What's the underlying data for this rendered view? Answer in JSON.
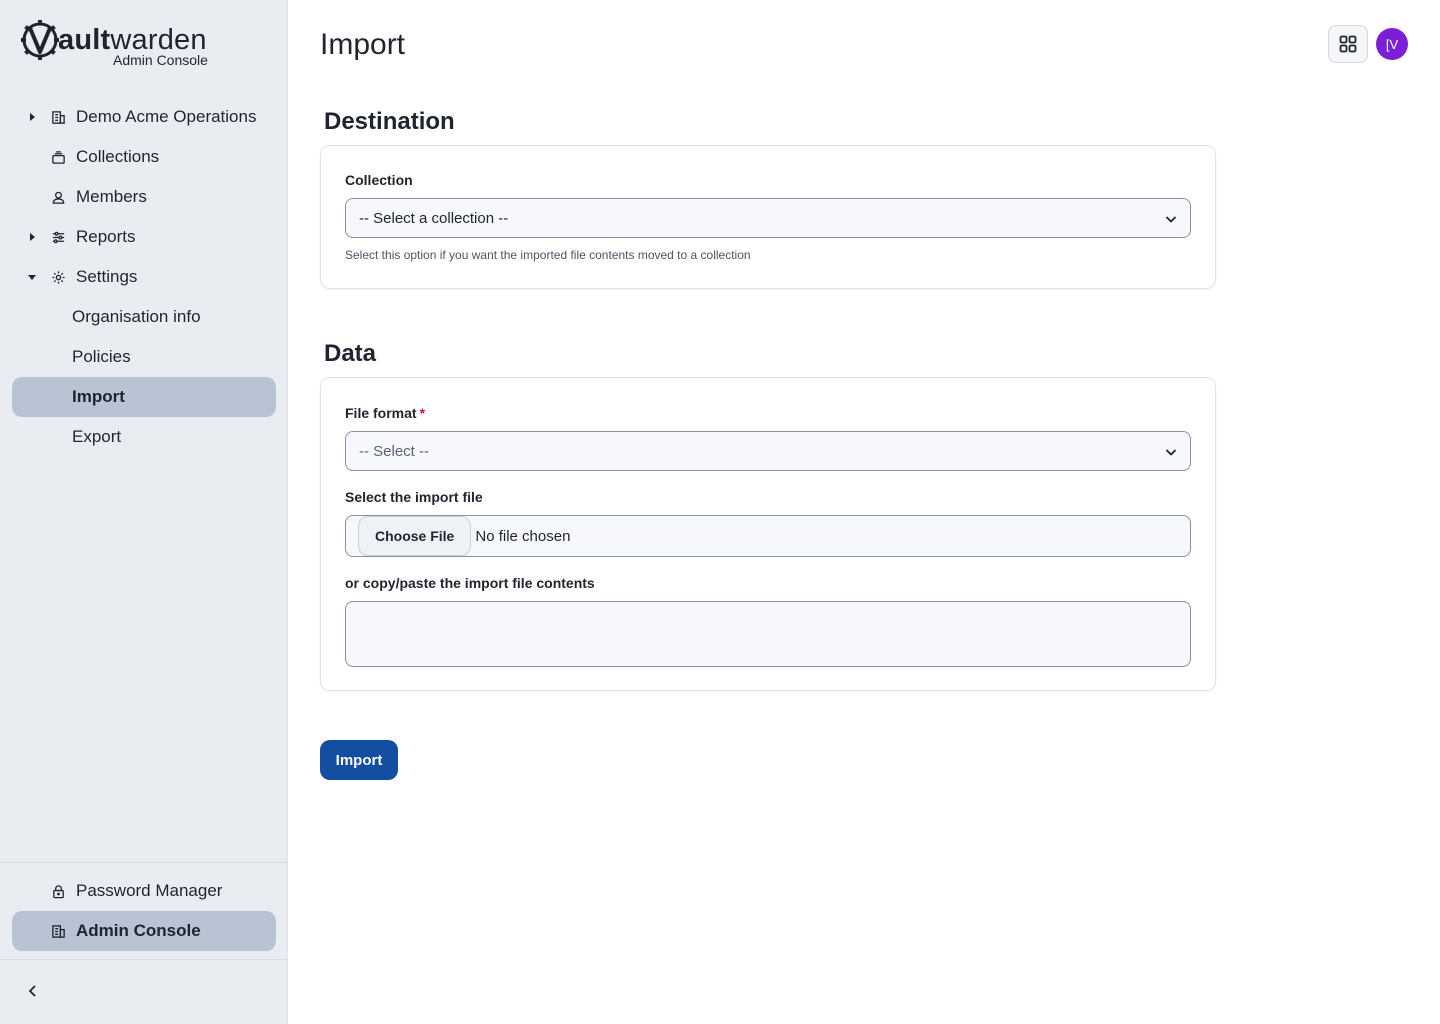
{
  "logo": {
    "word_bold": "ault",
    "word_regular": "warden",
    "subtitle": "Admin Console"
  },
  "sidebar": {
    "items": [
      {
        "label": "Demo Acme Operations",
        "icon": "building-icon",
        "caret": "right"
      },
      {
        "label": "Collections",
        "icon": "collection-icon"
      },
      {
        "label": "Members",
        "icon": "user-icon"
      },
      {
        "label": "Reports",
        "icon": "sliders-icon",
        "caret": "right"
      },
      {
        "label": "Settings",
        "icon": "gear-icon",
        "caret": "down"
      }
    ],
    "settings_children": [
      {
        "label": "Organisation info"
      },
      {
        "label": "Policies"
      },
      {
        "label": "Import",
        "active": true
      },
      {
        "label": "Export"
      }
    ],
    "footer": [
      {
        "label": "Password Manager",
        "icon": "lock-icon"
      },
      {
        "label": "Admin Console",
        "icon": "building-icon",
        "active": true
      }
    ]
  },
  "header": {
    "title": "Import",
    "avatar_initials": "[V"
  },
  "destination": {
    "title": "Destination",
    "collection_label": "Collection",
    "collection_value": "-- Select a collection --",
    "collection_hint": "Select this option if you want the imported file contents moved to a collection"
  },
  "data": {
    "title": "Data",
    "format_label": "File format",
    "format_required": "*",
    "format_value": "-- Select --",
    "file_label": "Select the import file",
    "file_button": "Choose File",
    "file_status": "No file chosen",
    "paste_label": "or copy/paste the import file contents"
  },
  "actions": {
    "import_button": "Import"
  },
  "colors": {
    "primary": "#134ea3",
    "avatar": "#7a1fd6",
    "sidebar_bg": "#e9edf2",
    "active_bg": "#b8c3d3",
    "required": "#c0192d"
  }
}
